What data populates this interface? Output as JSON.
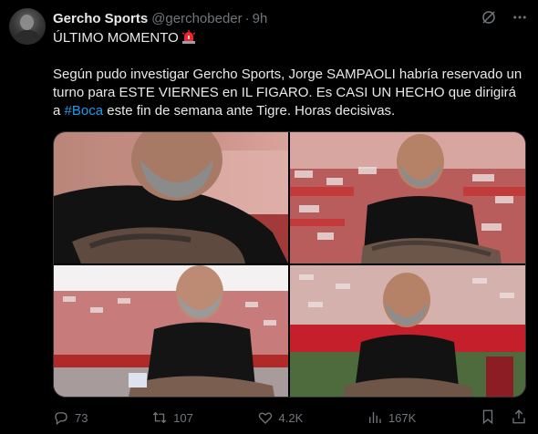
{
  "tweet": {
    "author_name": "Gercho Sports",
    "author_handle": "@gerchobeder",
    "separator": "·",
    "timestamp": "9h",
    "headline": "ÚLTIMO MOMENTO",
    "body_part1": "Según pudo investigar Gercho Sports, Jorge SAMPAOLI habría reservado un turno para ESTE VIERNES en IL FIGARO. Es CASI UN HECHO que dirigirá a ",
    "hashtag": "#Boca",
    "body_part2": " este fin de semana ante Tigre. Horas decisivas."
  },
  "media": {
    "photos": [
      {
        "description_icon": "photo-icon"
      },
      {
        "description_icon": "photo-icon"
      },
      {
        "description_icon": "photo-icon"
      },
      {
        "description_icon": "photo-icon"
      }
    ]
  },
  "actions": {
    "replies": "73",
    "reposts": "107",
    "likes": "4.2K",
    "views": "167K"
  },
  "colors": {
    "background": "#000000",
    "text": "#e7e9ea",
    "muted": "#71767b",
    "link": "#1d9bf0",
    "siren": "#f4212e"
  }
}
